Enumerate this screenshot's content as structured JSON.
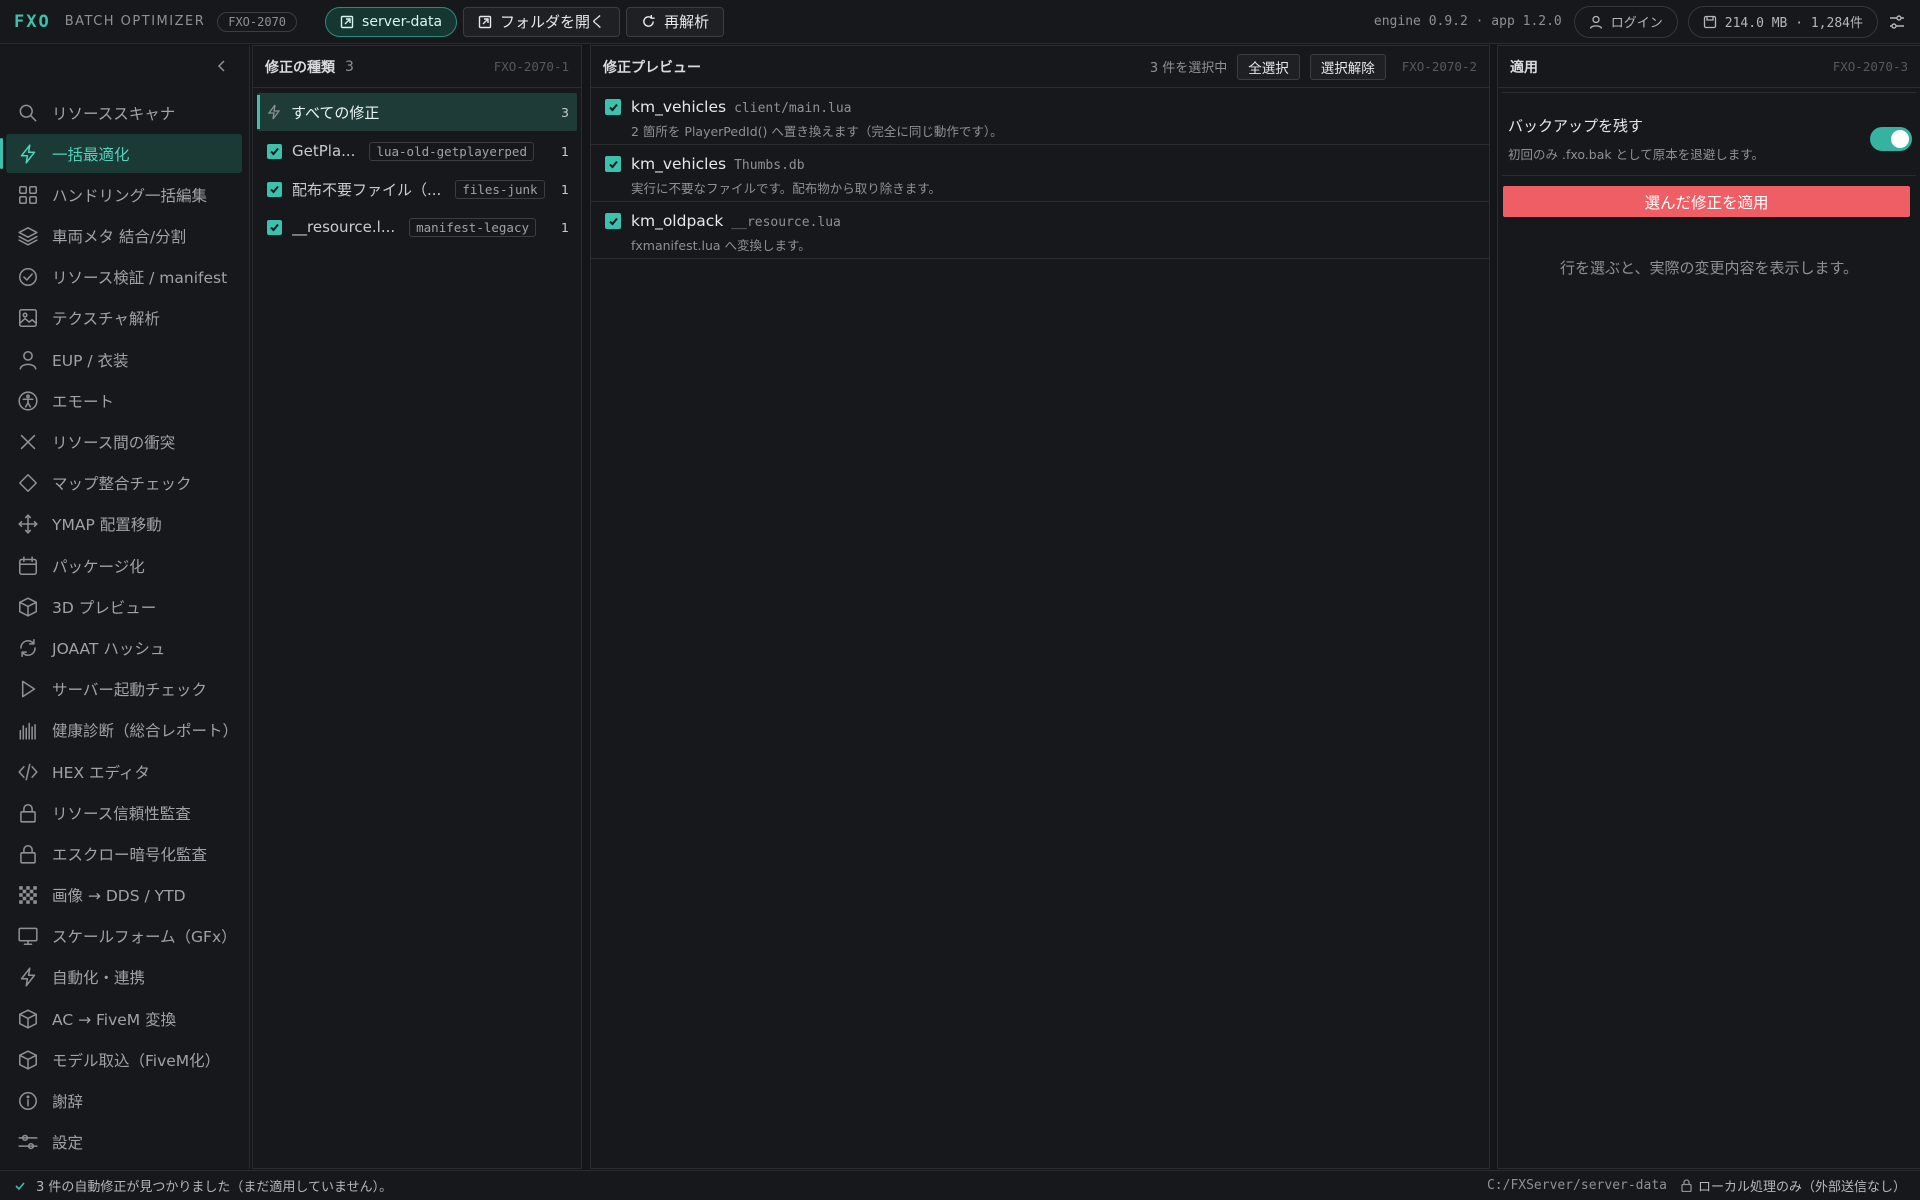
{
  "app": {
    "brand": "FXO",
    "subtitle": "BATCH OPTIMIZER",
    "build": "FXO-2070"
  },
  "toolbar": {
    "server_pill": "server-data",
    "open_folder": "フォルダを開く",
    "reanalyze": "再解析",
    "version": "engine 0.9.2 · app 1.2.0",
    "login": "ログイン",
    "stats": "214.0 MB · 1,284件"
  },
  "sidebar": {
    "items": [
      {
        "label": "リソーススキャナ",
        "icon": "search-icon"
      },
      {
        "label": "一括最適化",
        "icon": "bolt-icon",
        "active": true
      },
      {
        "label": "ハンドリング一括編集",
        "icon": "grid-icon"
      },
      {
        "label": "車両メタ 結合/分割",
        "icon": "layers-icon"
      },
      {
        "label": "リソース検証 / manifest",
        "icon": "check-circle-icon"
      },
      {
        "label": "テクスチャ解析",
        "icon": "image-icon"
      },
      {
        "label": "EUP / 衣装",
        "icon": "user-icon"
      },
      {
        "label": "エモート",
        "icon": "accessibility-icon"
      },
      {
        "label": "リソース間の衝突",
        "icon": "x-icon"
      },
      {
        "label": "マップ整合チェック",
        "icon": "diamond-icon"
      },
      {
        "label": "YMAP 配置移動",
        "icon": "move-icon"
      },
      {
        "label": "パッケージ化",
        "icon": "calendar-icon"
      },
      {
        "label": "3D プレビュー",
        "icon": "cube-icon"
      },
      {
        "label": "JOAAT ハッシュ",
        "icon": "refresh-icon"
      },
      {
        "label": "サーバー起動チェック",
        "icon": "play-icon"
      },
      {
        "label": "健康診断（総合レポート）",
        "icon": "bars-icon"
      },
      {
        "label": "HEX エディタ",
        "icon": "code-icon"
      },
      {
        "label": "リソース信頼性監査",
        "icon": "lock-icon"
      },
      {
        "label": "エスクロー暗号化監査",
        "icon": "lock-icon"
      },
      {
        "label": "画像 → DDS / YTD",
        "icon": "checker-icon"
      },
      {
        "label": "スケールフォーム（GFx）",
        "icon": "monitor-icon"
      },
      {
        "label": "自動化・連携",
        "icon": "bolt-icon"
      },
      {
        "label": "AC → FiveM 変換",
        "icon": "cube-icon"
      },
      {
        "label": "モデル取込（FiveM化）",
        "icon": "cube-icon"
      },
      {
        "label": "謝辞",
        "icon": "info-icon"
      },
      {
        "label": "設定",
        "icon": "sliders-icon"
      }
    ]
  },
  "categories": {
    "title": "修正の種類",
    "count": "3",
    "code": "FXO-2070-1",
    "all_label": "すべての修正",
    "all_count": "3",
    "items": [
      {
        "label": "GetPla...",
        "tag": "lua-old-getplayerped",
        "count": "1"
      },
      {
        "label": "配布不要ファイル（...",
        "tag": "files-junk",
        "count": "1"
      },
      {
        "label": "__resource.l...",
        "tag": "manifest-legacy",
        "count": "1"
      }
    ]
  },
  "preview": {
    "title": "修正プレビュー",
    "selected": "3 件を選択中",
    "select_all": "全選択",
    "deselect": "選択解除",
    "code": "FXO-2070-2",
    "rows": [
      {
        "name": "km_vehicles",
        "path": "client/main.lua",
        "desc": "2 箇所を PlayerPedId() へ置き換えます（完全に同じ動作です）。"
      },
      {
        "name": "km_vehicles",
        "path": "Thumbs.db",
        "desc": "実行に不要なファイルです。配布物から取り除きます。"
      },
      {
        "name": "km_oldpack",
        "path": "__resource.lua",
        "desc": "fxmanifest.lua へ変換します。"
      }
    ]
  },
  "apply": {
    "title": "適用",
    "code": "FXO-2070-3",
    "backup_title": "バックアップを残す",
    "backup_sub": "初回のみ .fxo.bak として原本を退避します。",
    "backup_enabled": true,
    "apply_button": "選んだ修正を適用",
    "hint": "行を選ぶと、実際の変更内容を表示します。"
  },
  "status": {
    "message": "3 件の自動修正が見つかりました（まだ適用していません）。",
    "path": "C:/FXServer/server-data",
    "local": "ローカル処理のみ（外部送信なし）"
  },
  "colors": {
    "accent": "#3cc1ad",
    "danger": "#ef5d65",
    "background": "#141518"
  }
}
